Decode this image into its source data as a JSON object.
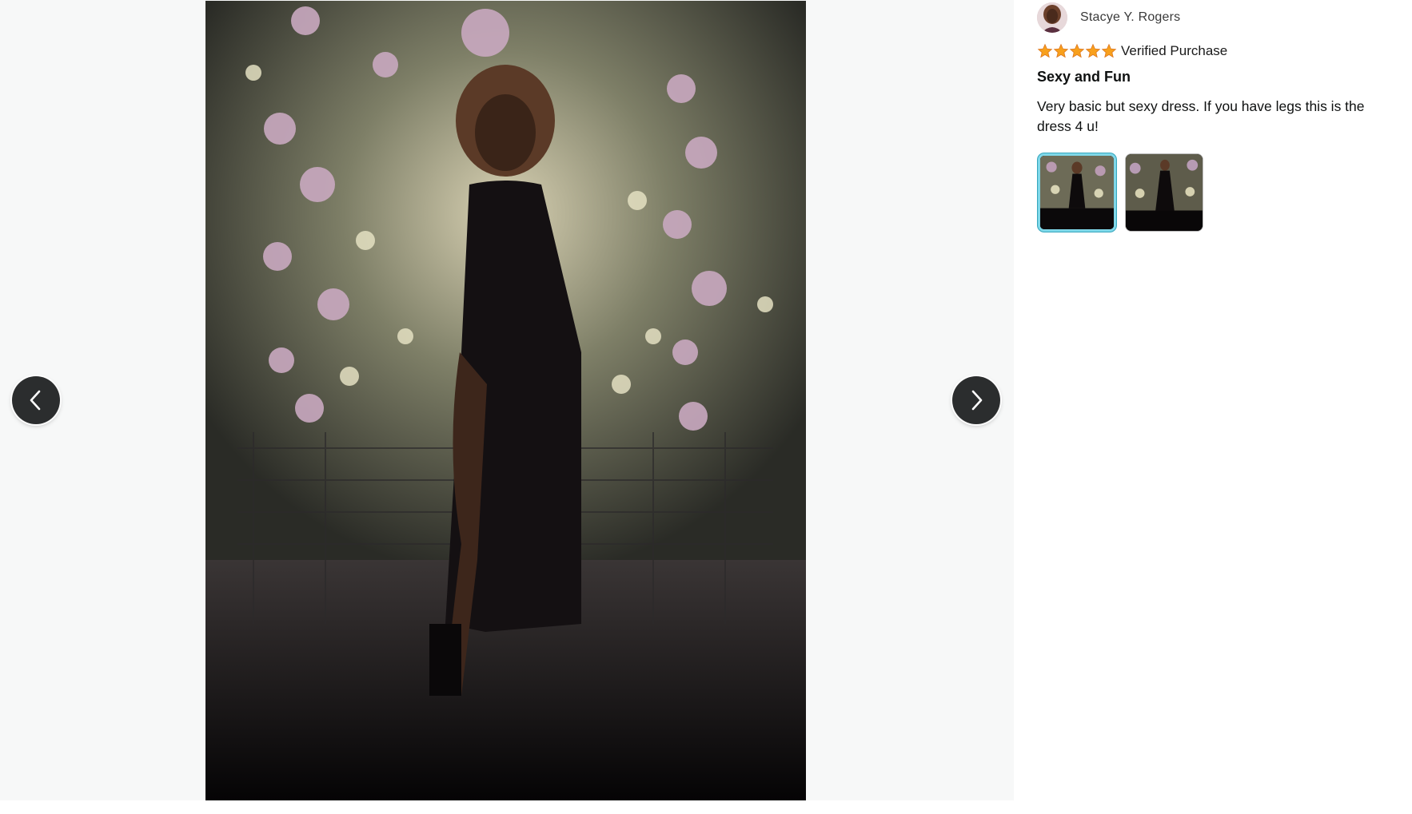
{
  "gallery": {
    "main_image": {
      "description_icon": "review-photo"
    },
    "prev_button": {
      "icon": "chevron-left-icon"
    },
    "next_button": {
      "icon": "chevron-right-icon"
    }
  },
  "review": {
    "reviewer_name": "Stacye Y. Rogers",
    "rating": 5,
    "rating_max": 5,
    "verified_label": "Verified Purchase",
    "title": "Sexy and Fun",
    "body": "Very basic but sexy dress. If you have legs this is the dress 4 u!",
    "thumbnails": [
      {
        "selected": true
      },
      {
        "selected": false
      }
    ]
  },
  "colors": {
    "star": "#f8a01c",
    "selected_thumb_border": "#7fd7e8",
    "nav_button": "#2b2d2e"
  }
}
